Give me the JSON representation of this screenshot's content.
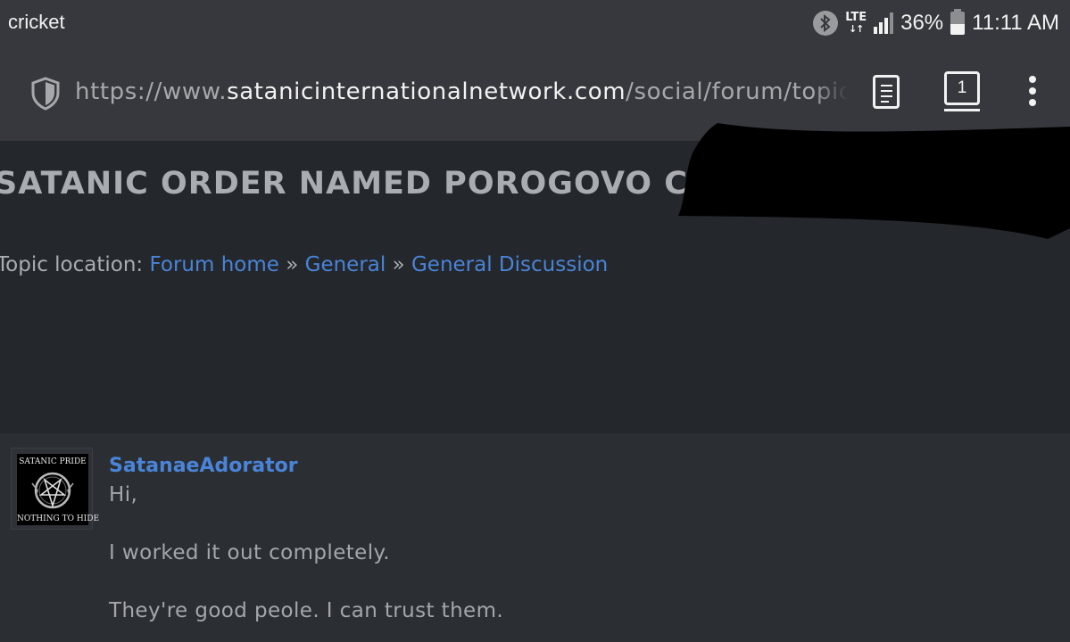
{
  "status_bar": {
    "carrier": "cricket",
    "network": "LTE",
    "battery": "36%",
    "time": "11:11 AM",
    "icons": [
      "bluetooth-icon",
      "lte-icon",
      "signal-icon",
      "battery-icon"
    ]
  },
  "browser": {
    "url_prefix": "https://www.",
    "url_domain": "satanicinternationalnetwork.com",
    "url_path": "/social/forum/topic/",
    "tab_count": "1",
    "icons": [
      "shield-icon",
      "reader-mode-icon",
      "tabs-icon",
      "menu-icon"
    ]
  },
  "page": {
    "title": "SATANIC ORDER NAMED POROGOVO CLUB",
    "breadcrumb": {
      "prefix": "Topic location: ",
      "items": [
        "Forum home",
        "General",
        "General Discussion"
      ],
      "separator": " » "
    },
    "post": {
      "avatar": {
        "top_text": "SATANIC PRIDE",
        "bottom_text": "NOTHING TO HIDE"
      },
      "author": "SatanaeAdorator",
      "lines": [
        "Hi,",
        "I worked it out completely.",
        "They're good peole. I can trust them."
      ]
    }
  },
  "colors": {
    "link": "#4a84d8",
    "chrome": "#37383d",
    "page_bg": "#24272b",
    "post_bg": "#2b2e33"
  }
}
